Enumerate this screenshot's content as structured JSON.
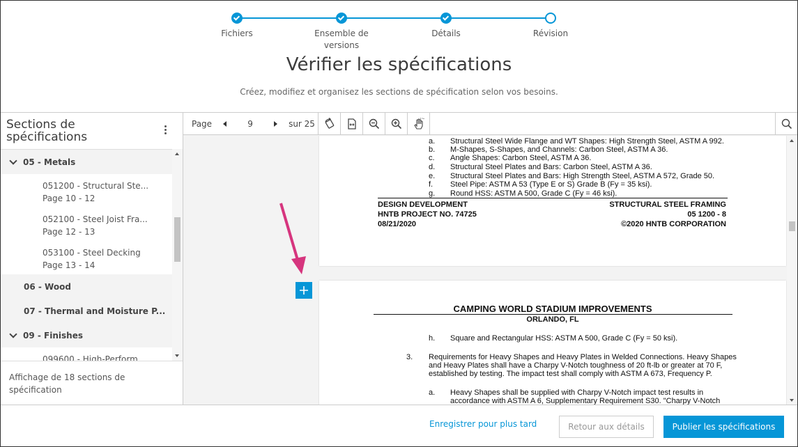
{
  "stepper": {
    "steps": [
      {
        "label": "Fichiers",
        "state": "done"
      },
      {
        "label": "Ensemble de versions",
        "state": "done"
      },
      {
        "label": "Détails",
        "state": "done"
      },
      {
        "label": "Révision",
        "state": "current"
      }
    ]
  },
  "header": {
    "title": "Vérifier les spécifications",
    "subtitle": "Créez, modifiez et organisez les sections de spécification selon vos besoins."
  },
  "sidebar": {
    "title": "Sections de spécifications",
    "groups": [
      {
        "label": "05 - Metals",
        "expanded": true
      },
      {
        "label": "06 - Wood",
        "expanded": false
      },
      {
        "label": "07 - Thermal and Moisture P...",
        "expanded": false
      },
      {
        "label": "09 - Finishes",
        "expanded": true
      }
    ],
    "items": [
      {
        "label": "051200 - Structural Ste...",
        "pages": "Page 10 - 12"
      },
      {
        "label": "052100 - Steel Joist Fra...",
        "pages": "Page 12 - 13"
      },
      {
        "label": "053100 - Steel Decking",
        "pages": "Page 13 - 14"
      },
      {
        "label": "099600 - High-Perform...",
        "pages": ""
      }
    ],
    "footer": "Affichage de 18 sections de spécification"
  },
  "toolbar": {
    "page_label": "Page",
    "page_number": "9",
    "of_label": "sur 25",
    "icons": [
      "rotate-icon",
      "fit-width-icon",
      "zoom-out-icon",
      "zoom-in-icon",
      "pan-hand-icon",
      "search-icon"
    ]
  },
  "document": {
    "page1": {
      "list": [
        {
          "k": "a.",
          "t": "Structural Steel Wide Flange and WT Shapes:  High Strength Steel, ASTM A 992."
        },
        {
          "k": "b.",
          "t": "M-Shapes, S-Shapes, and Channels:  Carbon Steel, ASTM A 36."
        },
        {
          "k": "c.",
          "t": "Angle Shapes:  Carbon Steel, ASTM A 36."
        },
        {
          "k": "d.",
          "t": "Structural Steel Plates and Bars:  Carbon Steel, ASTM A 36."
        },
        {
          "k": "e.",
          "t": "Structural Steel Plates and Bars:  High Strength Steel, ASTM A 572, Grade 50."
        },
        {
          "k": "f.",
          "t": "Steel Pipe:  ASTM A 53 (Type E or S) Grade B (Fy = 35 ksi)."
        },
        {
          "k": "g.",
          "t": "Round HSS:  ASTM A 500, Grade C (Fy = 46 ksi)."
        }
      ],
      "footer_left": [
        "DESIGN DEVELOPMENT",
        "HNTB PROJECT NO. 74725",
        "08/21/2020"
      ],
      "footer_right": [
        "STRUCTURAL STEEL FRAMING",
        "05 1200 - 8",
        "©2020 HNTB CORPORATION"
      ]
    },
    "page2": {
      "title": "CAMPING WORLD STADIUM IMPROVEMENTS",
      "location": "ORLANDO, FL",
      "h_key": "h.",
      "h_text": "Square and Rectangular HSS:  ASTM A 500, Grade C (Fy = 50 ksi).",
      "p3_key": "3.",
      "p3_lines": [
        "Requirements for Heavy Shapes and Heavy Plates in Welded Connections. Heavy Shapes",
        "and Heavy Plates shall have a Charpy V-Notch toughness of 20 ft-lb or greater at 70 F,",
        "established by testing. The impact test shall comply with ASTM A 673, Frequency P."
      ],
      "a_key": "a.",
      "a_lines": [
        "Heavy Shapes shall be supplied with Charpy V-Notch impact test results in",
        "accordance with ASTM A 6, Supplementary Requirement S30. \"Charpy V-Notch"
      ]
    }
  },
  "footer": {
    "save_later": "Enregistrer pour plus tard",
    "back": "Retour aux détails",
    "publish": "Publier les spécifications"
  },
  "colors": {
    "accent": "#0696d7",
    "annotation_arrow": "#d6357e"
  }
}
